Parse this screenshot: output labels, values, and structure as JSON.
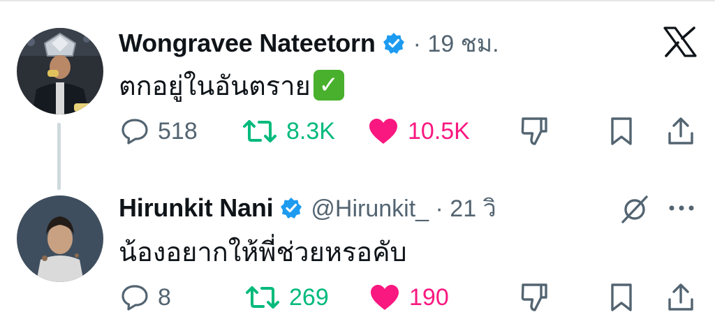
{
  "tweet1": {
    "display_name": "Wongravee Nateetorn",
    "meta": "· 19 ชม.",
    "text": "ตกอยู่ในอันตราย",
    "emoji": "white-heavy-check-mark",
    "stats": {
      "replies": "518",
      "reposts": "8.3K",
      "likes": "10.5K"
    },
    "liked": true,
    "reposted": true
  },
  "tweet2": {
    "display_name": "Hirunkit Nani",
    "meta": "@Hirunkit_ · 21 วิ",
    "text": "น้องอยากให้พี่ช่วยหรอคับ",
    "stats": {
      "replies": "8",
      "reposts": "269",
      "likes": "190"
    },
    "liked": true,
    "reposted": true
  },
  "colors": {
    "text": "#0f1419",
    "secondary": "#536471",
    "verified": "#1d9bf0",
    "repost": "#00ba7c",
    "like": "#f91880"
  }
}
